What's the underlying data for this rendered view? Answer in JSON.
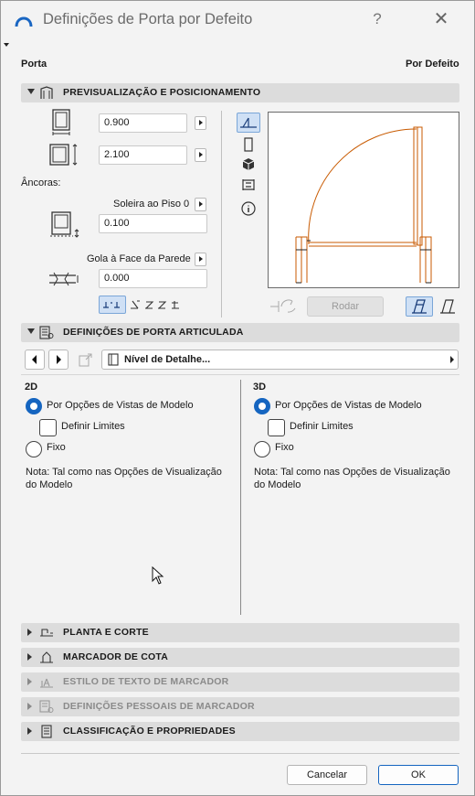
{
  "window": {
    "title": "Definições de Porta por Defeito",
    "help": "?",
    "close": "✕"
  },
  "header": {
    "element_type": "Porta",
    "default_label": "Por Defeito"
  },
  "sections": {
    "preview": "PREVISUALIZAÇÃO E POSICIONAMENTO",
    "hinged_door": "DEFINIÇÕES DE PORTA ARTICULADA",
    "plan_section": "PLANTA E CORTE",
    "dimension_marker": "MARCADOR DE COTA",
    "marker_text_style": "ESTILO DE TEXTO DE MARCADOR",
    "custom_marker": "DEFINIÇÕES PESSOAIS DE MARCADOR",
    "classification": "CLASSIFICAÇÃO E PROPRIEDADES"
  },
  "preview": {
    "width_value": "0.900",
    "height_value": "2.100",
    "anchors_label": "Âncoras:",
    "sill_anchor": "Soleira ao Piso 0",
    "sill_value": "0.100",
    "reveal_anchor": "Gola à Face da Parede",
    "reveal_value": "0.000",
    "rotate_button": "Rodar"
  },
  "hinged": {
    "detail_level": "Nível de Detalhe...",
    "col_2d": {
      "heading": "2D",
      "option_model": "Por Opções de Vistas de Modelo",
      "option_limits": "Definir Limites",
      "option_fixed": "Fixo",
      "note_line1": "Nota: Tal como nas Opções de Visualização",
      "note_line2": "do Modelo"
    },
    "col_3d": {
      "heading": "3D",
      "option_model": "Por Opções de Vistas de Modelo",
      "option_limits": "Definir Limites",
      "option_fixed": "Fixo",
      "note_line1": "Nota: Tal como nas Opções de Visualização",
      "note_line2": "do Modelo"
    }
  },
  "footer": {
    "cancel": "Cancelar",
    "ok": "OK"
  },
  "colors": {
    "accent": "#1565c0",
    "door_line": "#c85a00"
  }
}
